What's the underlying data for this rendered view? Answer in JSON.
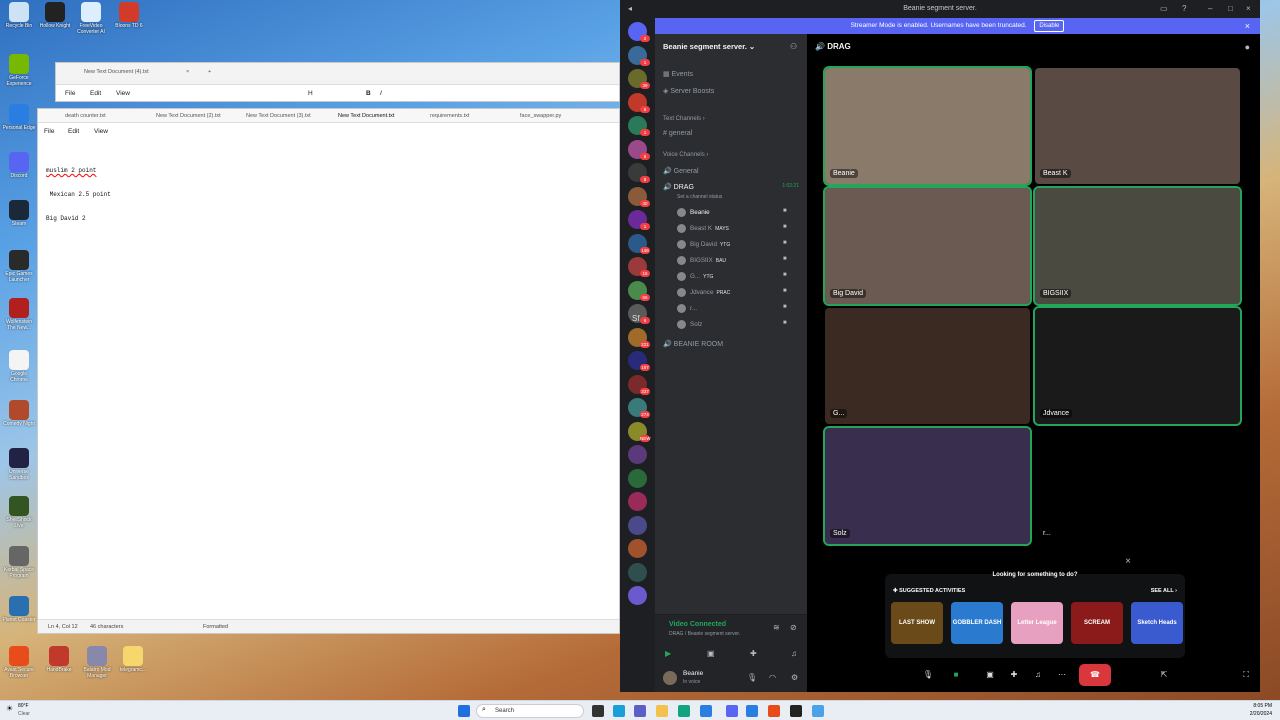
{
  "desktop": {
    "icons": [
      {
        "label": "Recycle Bin",
        "color": "#cde3f5"
      },
      {
        "label": "Hollow Knight",
        "color": "#222222"
      },
      {
        "label": "FreeVideo Converter AI",
        "color": "#ddeeff"
      },
      {
        "label": "Bloons TD 6",
        "color": "#d23b2a"
      },
      {
        "label": "GeForce Experience",
        "color": "#76b900"
      },
      {
        "label": "Personal Edge",
        "color": "#2a7de1"
      },
      {
        "label": "Discord",
        "color": "#5865f2"
      },
      {
        "label": "Steam",
        "color": "#1b2838"
      },
      {
        "label": "Epic Games Launcher",
        "color": "#2a2a2a"
      },
      {
        "label": "Wolfenstein The New...",
        "color": "#b21f1f"
      },
      {
        "label": "Google Chrome",
        "color": "#f4f4f4"
      },
      {
        "label": "Comedy Night",
        "color": "#b04a2a"
      },
      {
        "label": "Universe Sandbox",
        "color": "#222244"
      },
      {
        "label": "ShellShock Live",
        "color": "#335522"
      },
      {
        "label": "Kerbal Space Program",
        "color": "#666666"
      },
      {
        "label": "Planet Coaster",
        "color": "#2a6fb0"
      },
      {
        "label": "Avast Secure Browser",
        "color": "#e84c1b"
      },
      {
        "label": "HandBrake",
        "color": "#c0392b"
      },
      {
        "label": "Balatro Mod Manager",
        "color": "#8888aa"
      },
      {
        "label": "telegramc...",
        "color": "#f5d76e"
      }
    ]
  },
  "notepad_back": {
    "tab_title": "New Text Document (4).txt",
    "menu": [
      "File",
      "Edit",
      "View"
    ],
    "toolbar": [
      "H",
      "B",
      "I"
    ]
  },
  "notepad_front": {
    "tabs": [
      "death counter.txt",
      "New Text Document (2).txt",
      "New Text Document (3).txt",
      "New Text Document.txt",
      "requirements.txt",
      "face_swapper.py"
    ],
    "menu": [
      "File",
      "Edit",
      "View"
    ],
    "lines": [
      "muslim 2 point",
      " Mexican 2.5 point",
      "Big David 2"
    ],
    "status": {
      "position": "Ln 4, Col 12",
      "chars": "46 characters",
      "format": "Formatted"
    }
  },
  "discord": {
    "window_title": "Beanie segment server.",
    "streamer_banner": "Streamer Mode is enabled. Usernames have been truncated.",
    "streamer_disable": "Disable",
    "guild_badges": [
      "2",
      "1",
      "39",
      "8",
      "1",
      "6",
      "8",
      "40",
      "1",
      "146",
      "16",
      "56",
      "6",
      "221",
      "187",
      "337",
      "274",
      "NEW"
    ],
    "sf_label": "Sf",
    "server_name": "Beanie segment server.",
    "server_items": [
      "Events",
      "Server Boosts"
    ],
    "text_category": "Text Channels",
    "text_channels": [
      "general"
    ],
    "voice_category": "Voice Channels",
    "voice_channels": [
      {
        "name": "General"
      },
      {
        "name": "DRAG",
        "timer": "1:02:21",
        "status": "Set a channel status"
      }
    ],
    "voice_users": [
      {
        "name": "Beanie",
        "tag": ""
      },
      {
        "name": "Beast K",
        "tag": "MAYS"
      },
      {
        "name": "Big David",
        "tag": "YTG"
      },
      {
        "name": "BIGSIIX",
        "tag": "BAU"
      },
      {
        "name": "G...",
        "tag": "YTG"
      },
      {
        "name": "Jdvance",
        "tag": "PRAC"
      },
      {
        "name": "r...",
        "tag": ""
      },
      {
        "name": "Solz",
        "tag": ""
      }
    ],
    "extra_channel": "BEANIE ROOM",
    "voice_connected": "Video Connected",
    "voice_sub": "DRAG / Beanie segment server.",
    "self_user": "Beanie",
    "self_status": "In voice",
    "channel_title": "DRAG",
    "tiles": [
      {
        "name": "Beanie",
        "color": "#8a7a6a",
        "speaking": true
      },
      {
        "name": "Beast K",
        "color": "#5a4a44",
        "speaking": false
      },
      {
        "name": "Big David",
        "color": "#6b5a52",
        "speaking": true
      },
      {
        "name": "BIGSIIX",
        "color": "#4a4a40",
        "speaking": true
      },
      {
        "name": "G...",
        "color": "#3a2a22",
        "speaking": false
      },
      {
        "name": "Jdvance",
        "color": "#1a1a1a",
        "speaking": true
      },
      {
        "name": "Solz",
        "color": "#3a2e4e",
        "speaking": true
      },
      {
        "name": "r...",
        "color": "#000000",
        "speaking": false
      }
    ],
    "suggest_prompt": "Looking for something to do?",
    "suggest_title": "SUGGESTED ACTIVITIES",
    "see_all": "SEE ALL",
    "activities": [
      {
        "name": "LAST SHOW",
        "color": "#6b4a1a"
      },
      {
        "name": "GOBBLER DASH",
        "color": "#2a7bd0"
      },
      {
        "name": "Letter League",
        "color": "#e8a0c0"
      },
      {
        "name": "SCREAM",
        "color": "#8b1a1a"
      },
      {
        "name": "Sketch Heads",
        "color": "#3a5ad0"
      }
    ]
  },
  "taskbar": {
    "weather_temp": "80°F",
    "weather_desc": "Clear",
    "search": "Search",
    "time": "8:05 PM",
    "date": "2/20/2024"
  }
}
